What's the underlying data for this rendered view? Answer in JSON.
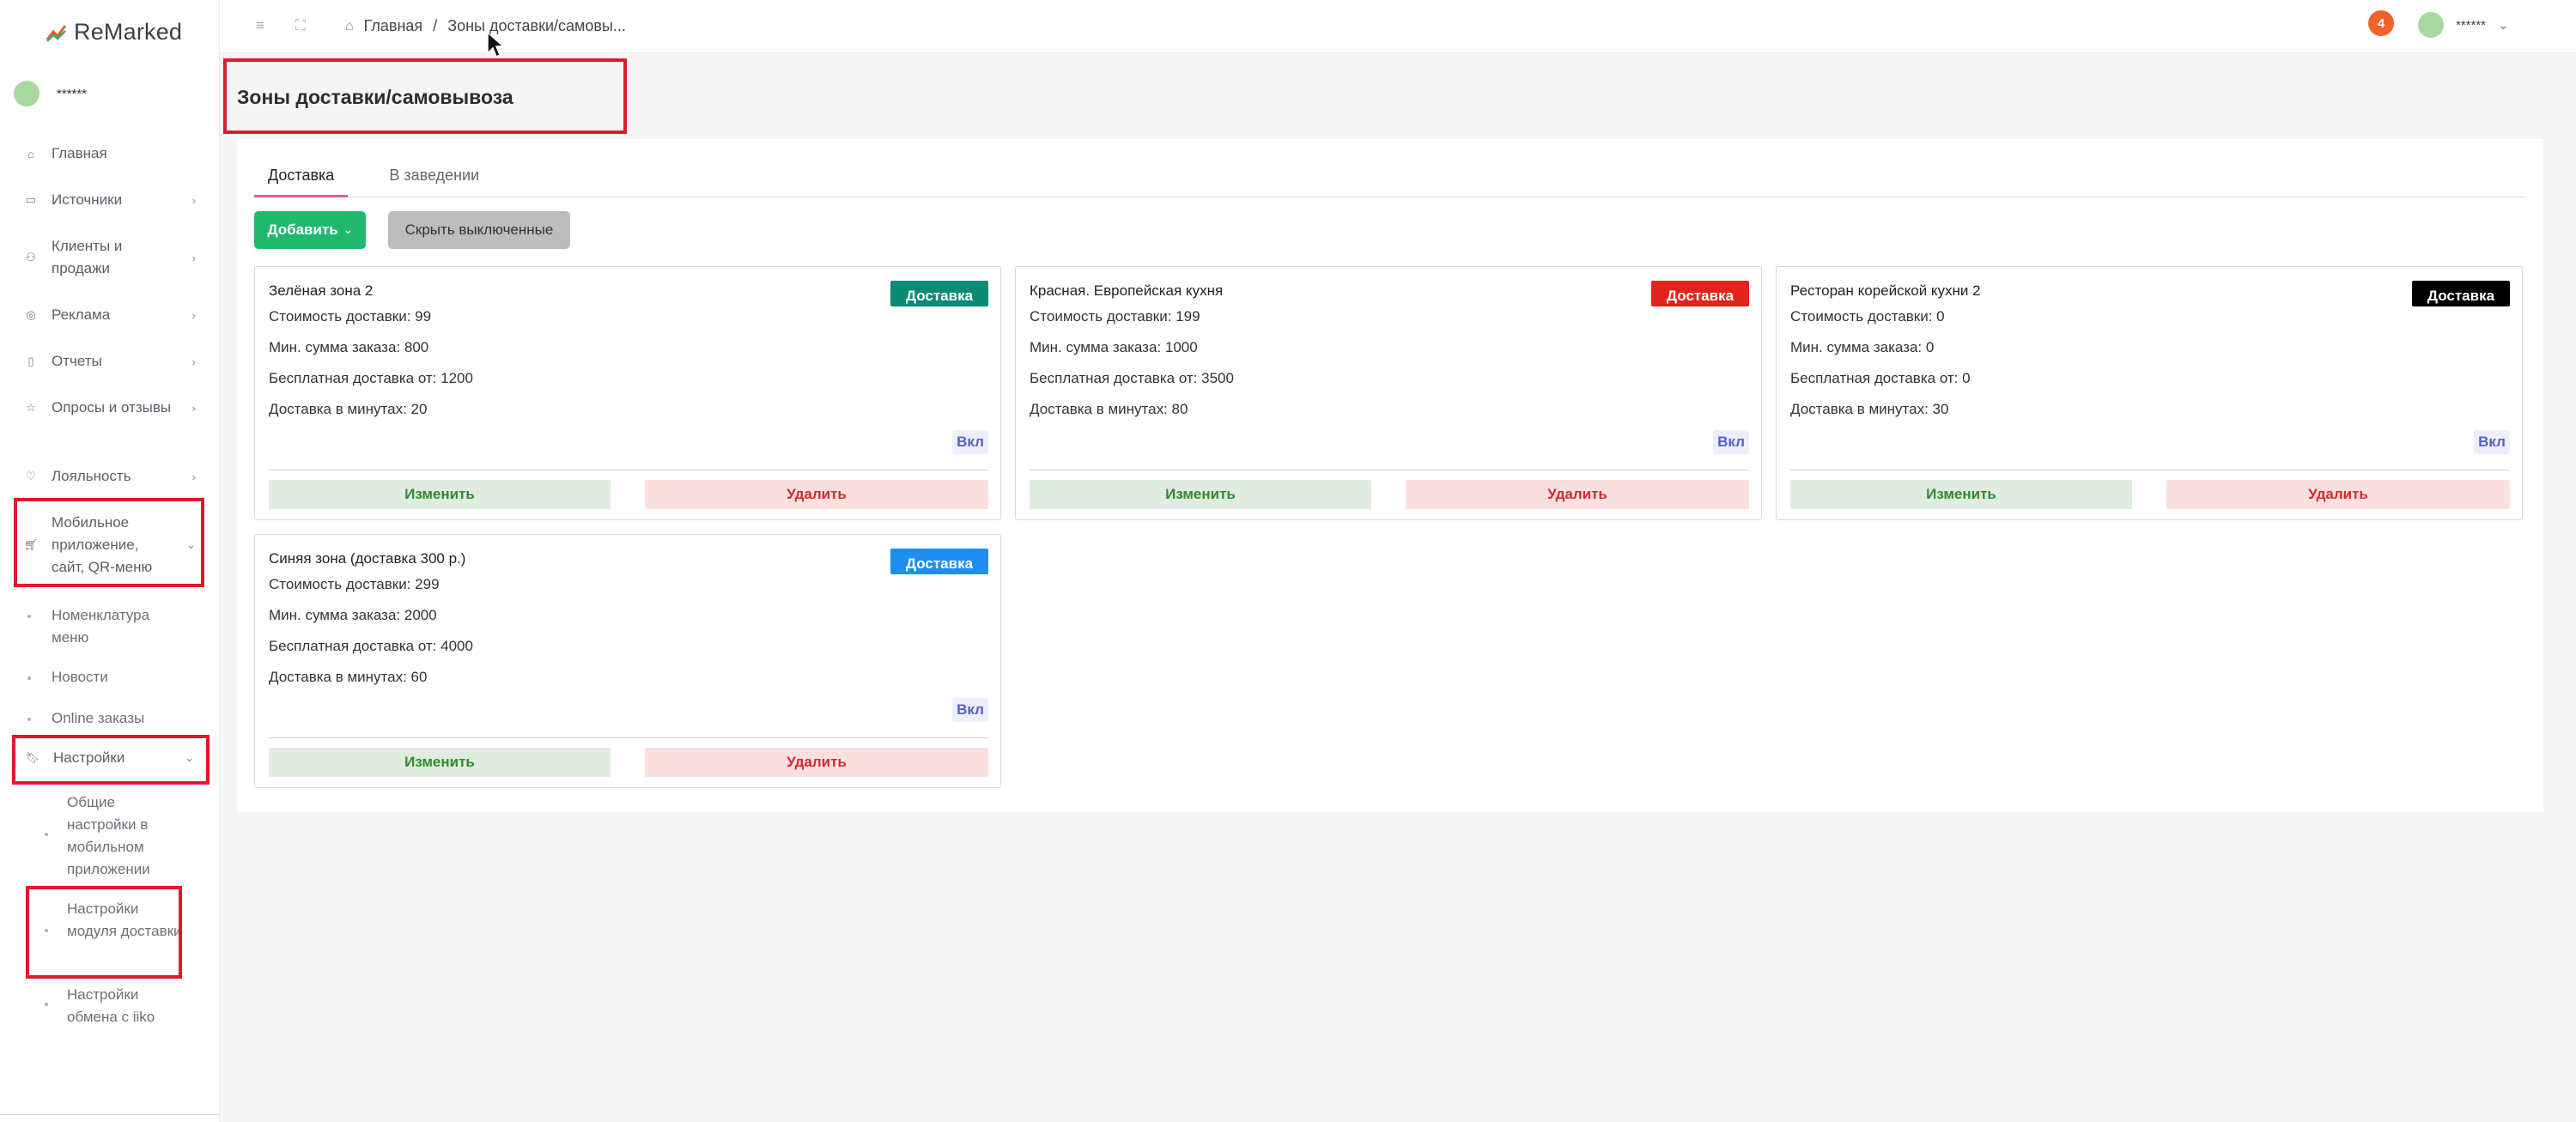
{
  "app": {
    "logo_text": "ReMarked",
    "user_name": "******"
  },
  "sidebar": {
    "items": [
      {
        "label": "Главная",
        "icon": "home-icon"
      },
      {
        "label": "Источники",
        "icon": "monitor-icon"
      },
      {
        "label": "Клиенты и продажи",
        "icon": "users-icon"
      },
      {
        "label": "Реклама",
        "icon": "target-icon"
      },
      {
        "label": "Отчеты",
        "icon": "report-icon"
      },
      {
        "label": "Опросы и отзывы",
        "icon": "star-icon"
      },
      {
        "label": "Лояльность",
        "icon": "heart-icon"
      },
      {
        "label": "Мобильное приложение, сайт, QR-меню",
        "icon": "cart-icon"
      }
    ],
    "mobile_sub": [
      {
        "label": "Номенклатура меню"
      },
      {
        "label": "Новости"
      },
      {
        "label": "Online заказы"
      }
    ],
    "settings": {
      "label": "Настройки",
      "icon": "bookmark-icon"
    },
    "settings_sub": [
      {
        "label": "Общие настройки в мобильном приложении"
      },
      {
        "label": "Настройки модуля доставки"
      },
      {
        "label": "Настройки обмена с iiko"
      }
    ]
  },
  "topbar": {
    "breadcrumb_home": "Главная",
    "breadcrumb_sep": "/",
    "breadcrumb_current": "Зоны доставки/самовы...",
    "notification_count": "4",
    "user_name": "******"
  },
  "page": {
    "title": "Зоны доставки/самовывоза",
    "tabs": [
      "Доставка",
      "В заведении"
    ],
    "add_button": "Добавить",
    "hide_button": "Скрыть выключенные"
  },
  "zones": [
    {
      "name": "Зелёная зона 2",
      "badge": "Доставка",
      "badge_color": "#0c8b74",
      "delivery_cost": "Стоимость доставки: 99",
      "min_order": "Мин. сумма заказа: 800",
      "free_from": "Бесплатная доставка от: 1200",
      "minutes": "Доставка в минутах: 20",
      "toggle": "Вкл",
      "edit": "Изменить",
      "delete": "Удалить"
    },
    {
      "name": "Красная. Европейская кухня",
      "badge": "Доставка",
      "badge_color": "#e0231c",
      "delivery_cost": "Стоимость доставки: 199",
      "min_order": "Мин. сумма заказа: 1000",
      "free_from": "Бесплатная доставка от: 3500",
      "minutes": "Доставка в минутах: 80",
      "toggle": "Вкл",
      "edit": "Изменить",
      "delete": "Удалить"
    },
    {
      "name": "Ресторан корейской кухни 2",
      "badge": "Доставка",
      "badge_color": "#000000",
      "delivery_cost": "Стоимость доставки: 0",
      "min_order": "Мин. сумма заказа: 0",
      "free_from": "Бесплатная доставка от: 0",
      "minutes": "Доставка в минутах: 30",
      "toggle": "Вкл",
      "edit": "Изменить",
      "delete": "Удалить"
    },
    {
      "name": "Синяя зона (доставка 300 р.)",
      "badge": "Доставка",
      "badge_color": "#1d8ef0",
      "delivery_cost": "Стоимость доставки: 299",
      "min_order": "Мин. сумма заказа: 2000",
      "free_from": "Бесплатная доставка от: 4000",
      "minutes": "Доставка в минутах: 60",
      "toggle": "Вкл",
      "edit": "Изменить",
      "delete": "Удалить"
    }
  ],
  "colors": {
    "accent_green": "#1fb86c",
    "highlight_red": "#e0192c",
    "notification": "#f2622b"
  }
}
